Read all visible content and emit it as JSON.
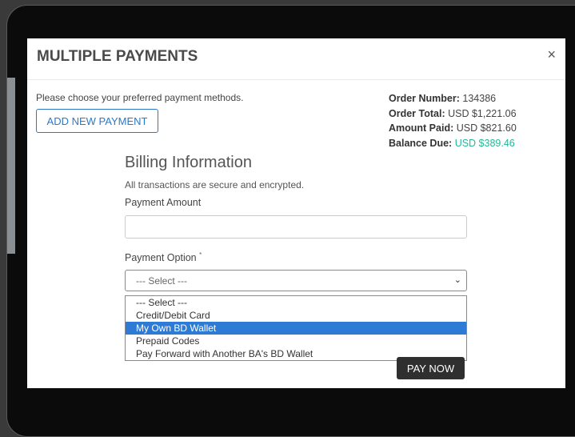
{
  "modal": {
    "title": "MULTIPLE PAYMENTS",
    "close": "×",
    "instructions": "Please choose your preferred payment methods.",
    "add_button": "ADD NEW PAYMENT"
  },
  "summary": {
    "order_number_label": "Order Number:",
    "order_number": "134386",
    "order_total_label": "Order Total:",
    "order_total": "USD $1,221.06",
    "amount_paid_label": "Amount Paid:",
    "amount_paid": "USD $821.60",
    "balance_due_label": "Balance Due:",
    "balance_due": "USD $389.46"
  },
  "billing": {
    "heading": "Billing Information",
    "secure_note": "All transactions are secure and encrypted.",
    "amount_label": "Payment Amount",
    "amount_value": "",
    "option_label": "Payment Option",
    "required_mark": "*",
    "selected_option": "--- Select ---",
    "options": [
      "--- Select ---",
      "Credit/Debit Card",
      "My Own BD Wallet",
      "Prepaid Codes",
      "Pay Forward with Another BA's BD Wallet"
    ],
    "highlighted_option_index": 2,
    "pay_button": "PAY NOW"
  },
  "colors": {
    "accent": "#2d78c5",
    "balance_due": "#22b89a",
    "highlight": "#2e7bd6"
  }
}
